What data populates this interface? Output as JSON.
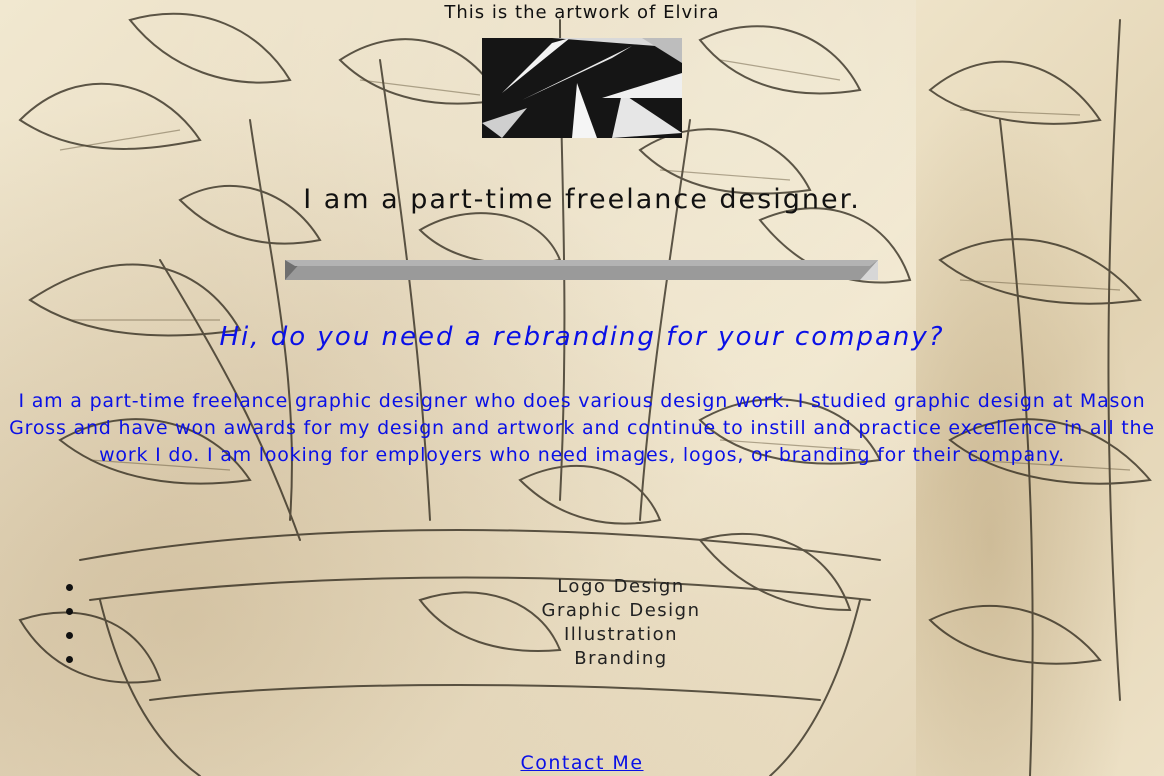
{
  "header": {
    "title": "This is the artwork of Elvira"
  },
  "hero": {
    "tagline": "I am a part-time freelance designer."
  },
  "about": {
    "heading": "Hi, do you need a rebranding for your company?",
    "body": "I am a part-time freelance graphic designer who does various design work. I studied graphic design at Mason Gross and have won awards for my design and artwork and continue to instill and practice excellence in all the work I do. I am looking for employers who need images, logos, or branding for their company."
  },
  "services": [
    "Logo Design",
    "Graphic Design",
    "Illustration",
    "Branding"
  ],
  "footer": {
    "contact_label": "Contact Me"
  },
  "colors": {
    "link": "#0a10e6",
    "text": "#111111",
    "background": "#eadfc6"
  }
}
